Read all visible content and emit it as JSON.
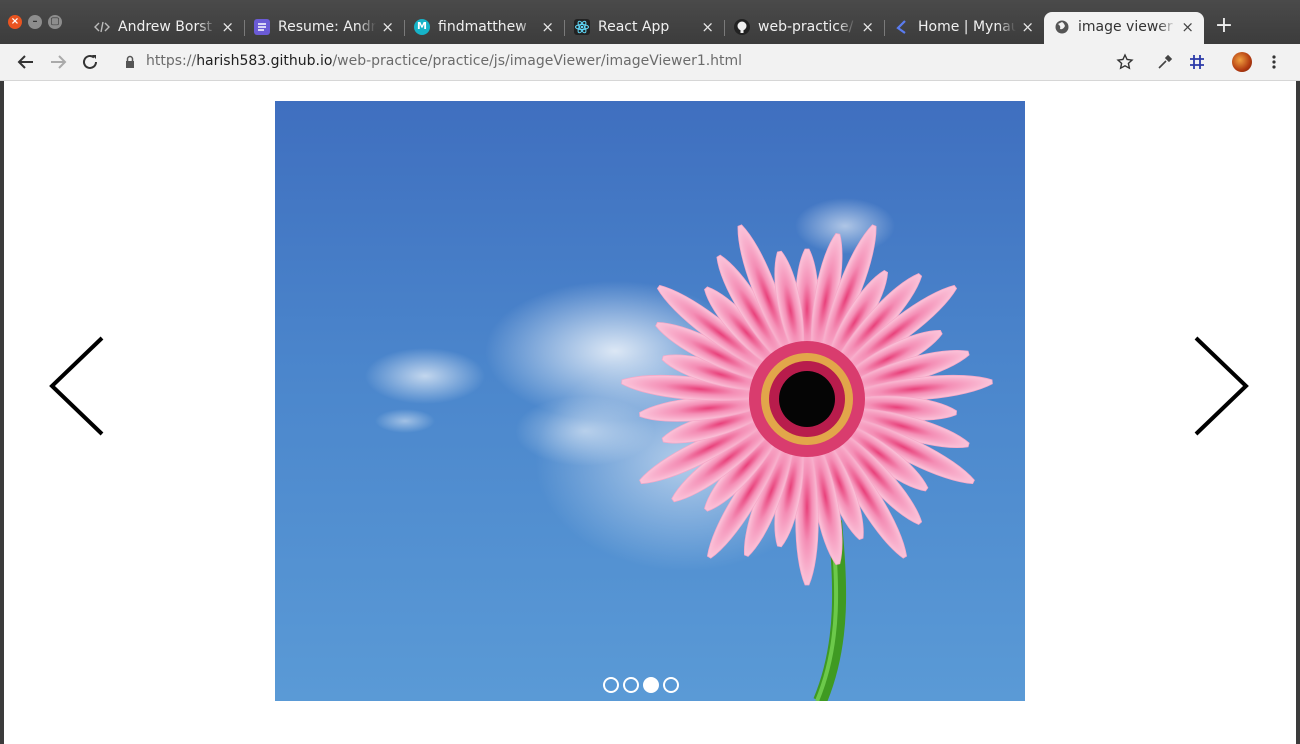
{
  "window": {
    "buttons": {
      "close": "×",
      "minimize": "–",
      "maximize": "▢"
    }
  },
  "tabs": [
    {
      "title": "Andrew Borst",
      "favicon": "code-icon",
      "close": "×"
    },
    {
      "title": "Resume: Andr",
      "favicon": "docs-icon",
      "close": "×"
    },
    {
      "title": "findmatthew",
      "favicon": "m-logo-icon",
      "close": "×"
    },
    {
      "title": "React App",
      "favicon": "react-icon",
      "close": "×"
    },
    {
      "title": "web-practice/",
      "favicon": "github-icon",
      "close": "×"
    },
    {
      "title": "Home | Mynau",
      "favicon": "k-logo-icon",
      "close": "×"
    },
    {
      "title": "image viewer",
      "favicon": "globe-icon",
      "close": "×",
      "active": true
    }
  ],
  "new_tab_label": "+",
  "toolbar": {
    "url_scheme": "https://",
    "url_host": "harish583.github.io",
    "url_path": "/web-practice/practice/js/imageViewer/imageViewer1.html"
  },
  "viewer": {
    "slide_count": 4,
    "active_slide": 3
  },
  "colors": {
    "ubuntu_close": "#e95420",
    "sky_top": "#3f6fbf",
    "sky_bottom": "#5a9ad6",
    "petal": "#f48fb6"
  }
}
